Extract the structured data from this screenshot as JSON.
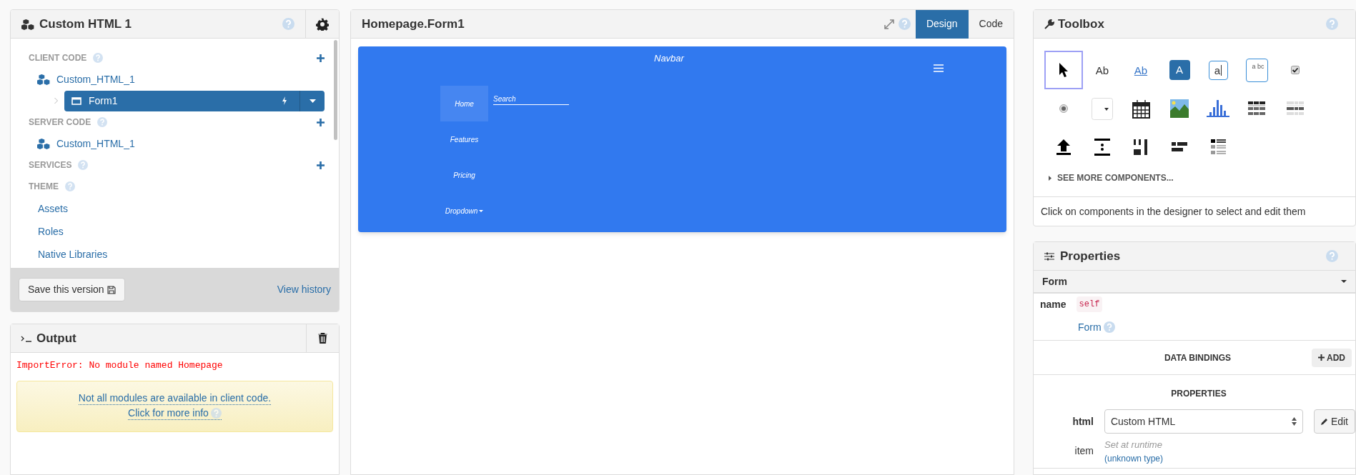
{
  "app_panel": {
    "title": "Custom HTML 1",
    "sections": [
      {
        "label": "CLIENT CODE",
        "addable": true,
        "items": [
          {
            "kind": "module",
            "label": "Custom_HTML_1",
            "children": [
              {
                "kind": "form",
                "label": "Form1",
                "selected": true
              }
            ]
          }
        ]
      },
      {
        "label": "SERVER CODE",
        "addable": true,
        "items": [
          {
            "kind": "module",
            "label": "Custom_HTML_1"
          }
        ]
      },
      {
        "label": "SERVICES",
        "addable": true
      },
      {
        "label": "THEME",
        "addable": false,
        "items": [
          {
            "kind": "link",
            "label": "Assets"
          },
          {
            "kind": "link",
            "label": "Roles"
          },
          {
            "kind": "link",
            "label": "Native Libraries"
          }
        ]
      }
    ],
    "save_button": "Save this version",
    "history_link": "View history"
  },
  "output": {
    "title": "Output",
    "error": "ImportError: No module named Homepage",
    "notice": [
      "Not all modules are available in client code.",
      "Click for more info"
    ]
  },
  "editor": {
    "title": "Homepage.Form1",
    "tabs": [
      {
        "label": "Design",
        "selected": true
      },
      {
        "label": "Code",
        "selected": false
      }
    ],
    "navbar": {
      "brand": "Navbar",
      "links": [
        {
          "label": "Home",
          "kind": "link",
          "selected": true
        },
        {
          "label": "Features",
          "kind": "link",
          "selected": false
        },
        {
          "label": "Pricing",
          "kind": "link",
          "selected": false
        },
        {
          "label": "Dropdown",
          "kind": "dropdown",
          "selected": false
        }
      ],
      "search": {
        "placeholder": "Search"
      }
    }
  },
  "toolbox": {
    "title": "Toolbox",
    "components": [
      {
        "kind": "pointer",
        "selected": true
      },
      {
        "kind": "label",
        "glyph": "Ab",
        "selected": false
      },
      {
        "kind": "link",
        "glyph": "Ab",
        "selected": false
      },
      {
        "kind": "button",
        "glyph": "A",
        "selected": false
      },
      {
        "kind": "textbox",
        "glyph": "a",
        "selected": false
      },
      {
        "kind": "textarea",
        "glyph": "a bc",
        "selected": false
      },
      {
        "kind": "checkbox",
        "selected": false
      },
      {
        "kind": "radio",
        "selected": false
      },
      {
        "kind": "dropdown",
        "selected": false
      },
      {
        "kind": "calendar",
        "selected": false
      },
      {
        "kind": "image",
        "selected": false
      },
      {
        "kind": "plot",
        "selected": false
      },
      {
        "kind": "grid",
        "selected": false
      },
      {
        "kind": "repeating",
        "selected": false
      },
      {
        "kind": "upload",
        "selected": false
      },
      {
        "kind": "spacer",
        "selected": false
      },
      {
        "kind": "columns",
        "selected": false
      },
      {
        "kind": "flow",
        "selected": false
      },
      {
        "kind": "list",
        "selected": false
      }
    ],
    "more": "SEE MORE COMPONENTS...",
    "hint": "Click on components in the designer to select and edit them"
  },
  "properties": {
    "title": "Properties",
    "component": "Form",
    "name_label": "name",
    "name_value": "self",
    "type_link": "Form",
    "data_bindings": "DATA BINDINGS",
    "add_button": "ADD",
    "section": "PROPERTIES",
    "rows": [
      {
        "kind": "select",
        "label": "html",
        "value": "Custom HTML",
        "button": "Edit"
      },
      {
        "kind": "runtime",
        "label": "item",
        "note": "Set at runtime",
        "type": "(unknown type)"
      }
    ]
  }
}
